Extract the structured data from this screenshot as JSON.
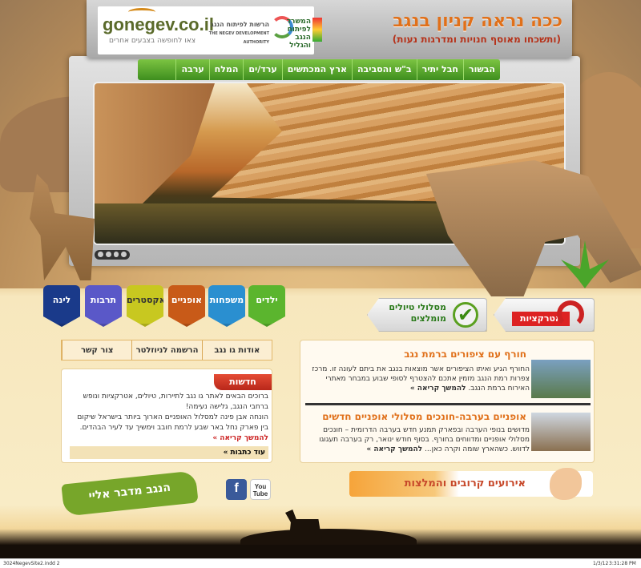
{
  "header": {
    "brand": "gonegev.co.il",
    "brand_tagline": "צאו לחופשה בצבעים אחרים",
    "authority_1": "הרשות לפיתוח הנגב",
    "authority_1_en": "THE NEGEV DEVELOPMENT AUTHORITY",
    "authority_2": "המשרד לפיתוח הנגב והגליל",
    "title": "ככה נראה קניון בנגב",
    "subtitle": "(ותשכחו מאוסף חנויות ומדרגות נעות)"
  },
  "nav": {
    "items": [
      "הבשור",
      "חבל יתיר",
      "ב\"ש והסביבה",
      "ארץ המכתשים",
      "ערד/ים",
      "המלח",
      "ערבה"
    ]
  },
  "categories": [
    {
      "label": "ילדים",
      "color": "#5bb52e"
    },
    {
      "label": "משפחות",
      "color": "#2a8fd0"
    },
    {
      "label": "אופניים",
      "color": "#c85a18"
    },
    {
      "label": "אקסטרים",
      "color": "#c8c820"
    },
    {
      "label": "תרבות",
      "color": "#5a58c8"
    },
    {
      "label": "לינה",
      "color": "#1a3a8a"
    }
  ],
  "banners": {
    "attractions": "אטרקציות",
    "routes": "מסלולי טיולים מומלצים"
  },
  "about_bar": {
    "items": [
      "אודות גו נגב",
      "הרשמה לניוזלטר",
      "צור קשר"
    ]
  },
  "news": {
    "tab": "חדשות",
    "text_1": "ברוכים הבאים לאתר גו נגב לתיירות, טיולים, אטרקציות ונופש ברחבי הנגב, גלישה נעימה!",
    "text_2": "הונחה אבן פינה למסלול האופניים הארוך ביותר בישראל שיקום בין פארק נחל באר שבע לרמת חובב וימשיך עד לעיר הבהדים.",
    "read_more": "להמשך קריאה »",
    "more_articles": "עוד כתבות »"
  },
  "events": {
    "item_1": {
      "title": "חורף עם ציפורים ברמת נגב",
      "text": "החורף הגיע ואיתו הציפורים אשר מוצאות בנגב את ביתם לעונה זו. מרכז צפרות רמת הנגב מזמין אתכם להצטרף לסופי שבוע במבחר מאתרי האירוח ברמת הנגב.",
      "read_more": "להמשך קריאה »"
    },
    "item_2": {
      "title": "אופניים בערבה-חונכים מסלולי אופניים חדשים",
      "text": "מדושים בנופי הערבה ובפארק תמנע חדש בערבה הדרומית – חונכים מסלולי אופניים ומדווחים בחורף. בסוף חודש ינואר, רק בערבה תעגוגו לדווש. כשהארץ שומה וקרה כאן...",
      "read_more": "להמשך קריאה »"
    },
    "footer_title": "אירועים קרובים והמלצות"
  },
  "social": {
    "facebook": "f",
    "youtube": "You Tube"
  },
  "slogan": "הנגב מדבר אליי",
  "print_info": {
    "file": "3024NegevSite2.indd 2",
    "date": "1/3/12",
    "time": "3:31:28 PM"
  }
}
